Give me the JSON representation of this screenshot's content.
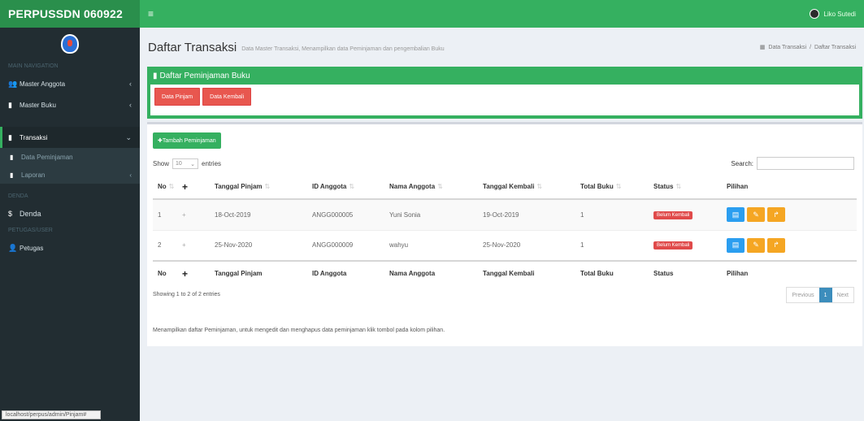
{
  "header": {
    "brand": "PERPUSSDN 060922",
    "menu_icon": "≡",
    "user_name": "Liko Sutedi"
  },
  "sidebar": {
    "section_main": "MAIN NAVIGATION",
    "items": [
      {
        "icon": "users-icon",
        "label": "Master Anggota",
        "arrow": "‹"
      },
      {
        "icon": "book-icon",
        "label": "Master Buku",
        "arrow": "‹"
      }
    ],
    "transaksi": {
      "label": "Transaksi",
      "arrow": "⌄"
    },
    "sub_items": [
      {
        "label": "Data Peminjaman"
      },
      {
        "label": "Laporan",
        "arrow": "‹"
      }
    ],
    "section_denda": "DENDA",
    "denda": {
      "icon": "$",
      "label": "Denda"
    },
    "section_petugas": "PETUGAS/USER",
    "petugas": {
      "label": "Petugas"
    }
  },
  "statusbar": "localhost/perpus/admin/Pinjam#",
  "content": {
    "title": "Daftar Transaksi",
    "subtitle": "Data Master Transaksi, Menampilkan data Peminjaman dan pengembalian Buku",
    "breadcrumb": [
      "Data Transaksi",
      "Daftar Transaksi"
    ],
    "panel_title": "Daftar Peminjaman Buku",
    "btn_pinjam": "Data Pinjam",
    "btn_kembali": "Data Kembali",
    "btn_tambah": "Tambah Peminjaman",
    "show_label": "Show",
    "show_value": "10",
    "entries_label": "entries",
    "search_label": "Search:",
    "columns": [
      "No",
      "Tanggal Pinjam",
      "ID Anggota",
      "Nama Anggota",
      "Tanggal Kembali",
      "Total Buku",
      "Status",
      "Pilihan"
    ],
    "rows": [
      {
        "no": "1",
        "tgl_pinjam": "18-Oct-2019",
        "id": "ANGG000005",
        "nama": "Yuni Sonia",
        "tgl_kembali": "19-Oct-2019",
        "total": "1",
        "status": "Belum Kembali"
      },
      {
        "no": "2",
        "tgl_pinjam": "25-Nov-2020",
        "id": "ANGG000009",
        "nama": "wahyu",
        "tgl_kembali": "25-Nov-2020",
        "total": "1",
        "status": "Belum Kembali"
      }
    ],
    "showing": "Showing 1 to 2 of 2 entries",
    "pager": {
      "prev": "Previous",
      "current": "1",
      "next": "Next"
    },
    "note": "Menampilkan daftar Peminjaman, untuk mengedit dan menghapus data peminjaman klik tombol pada kolom pilihan."
  },
  "colors": {
    "brand": "#2a8f4c",
    "accent": "#35b060",
    "sidebar": "#222d32",
    "danger": "#e8574f"
  }
}
